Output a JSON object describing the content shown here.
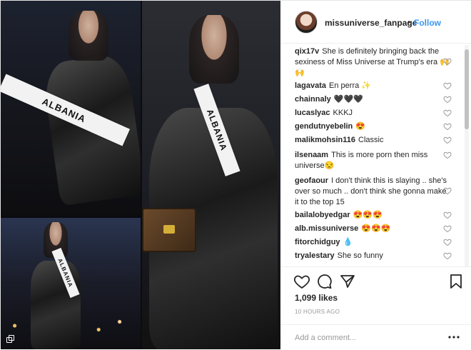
{
  "header": {
    "username": "missuniverse_fanpage",
    "separator": "•",
    "follow_label": "Follow"
  },
  "media": {
    "sash_text": "ALBANIA"
  },
  "comments": [
    {
      "user": "qix17v",
      "text": "She is definitely bringing back the sexiness of Miss Universe at Trump's era 🙌🙌"
    },
    {
      "user": "lagavata",
      "text": "En perra ✨"
    },
    {
      "user": "chainnaly",
      "text": "🖤🖤🖤"
    },
    {
      "user": "lucaslyac",
      "text": "KKKJ"
    },
    {
      "user": "gendutnyebelin",
      "text": "😍"
    },
    {
      "user": "malikmohsin116",
      "text": "Classic"
    },
    {
      "user": "ilsenaam",
      "text": "This is more porn then miss universe😒"
    },
    {
      "user": "geofaour",
      "text": "I don't think this is slaying .. she's over so much .. don't think she gonna make it to the top 15"
    },
    {
      "user": "bailalobyedgar",
      "text": "😍😍😍"
    },
    {
      "user": "alb.missuniverse",
      "text": "😍😍😍"
    },
    {
      "user": "fitorchidguy",
      "text": "💧"
    },
    {
      "user": "tryalestary",
      "text": "She so funny"
    }
  ],
  "stats": {
    "likes": "1,099 likes",
    "timestamp": "10 HOURS AGO"
  },
  "add_comment": {
    "placeholder": "Add a comment..."
  },
  "icons": {
    "like": "heart-icon",
    "comment": "comment-icon",
    "share": "share-icon",
    "save": "bookmark-icon",
    "more": "more-options-icon"
  },
  "colors": {
    "link_blue": "#3897f0",
    "text": "#262626",
    "muted": "#999999",
    "border": "#efefef"
  }
}
